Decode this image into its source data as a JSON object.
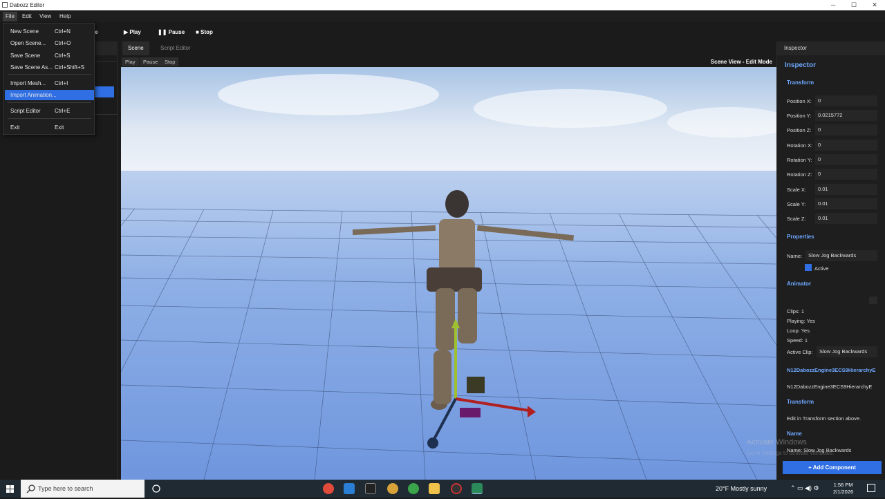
{
  "window": {
    "title": "Dabozz Editor",
    "minimize": "─",
    "maximize": "☐",
    "close": "✕"
  },
  "menubar": {
    "file": "File",
    "edit": "Edit",
    "view": "View",
    "help": "Help"
  },
  "toolbar": {
    "play": "▶ Play",
    "pause": "❚❚ Pause",
    "stop": "■ Stop",
    "partial": "e"
  },
  "file_menu": {
    "items": [
      {
        "label": "New Scene",
        "shortcut": "Ctrl+N"
      },
      {
        "label": "Open Scene...",
        "shortcut": "Ctrl+O"
      },
      {
        "label": "Save Scene",
        "shortcut": "Ctrl+S"
      },
      {
        "label": "Save Scene As...",
        "shortcut": "Ctrl+Shift+S"
      },
      {
        "label": "Import Mesh...",
        "shortcut": "Ctrl+I"
      },
      {
        "label": "Import Animation...",
        "shortcut": ""
      },
      {
        "label": "Script Editor",
        "shortcut": "Ctrl+E"
      },
      {
        "label": "Exit",
        "shortcut": "Exit"
      }
    ]
  },
  "tabs": [
    {
      "label": "Scene"
    },
    {
      "label": "Script Editor"
    }
  ],
  "viewbar": {
    "play": "Play",
    "pause": "Pause",
    "stop": "Stop",
    "mode": "Scene View - Edit Mode"
  },
  "inspector": {
    "tab": "Inspector",
    "header": "Inspector",
    "transform_title": "Transform",
    "fields": [
      {
        "label": "Position X:",
        "value": "0"
      },
      {
        "label": "Position Y:",
        "value": "0.0215772"
      },
      {
        "label": "Position Z:",
        "value": "0"
      },
      {
        "label": "Rotation X:",
        "value": "0"
      },
      {
        "label": "Rotation Y:",
        "value": "0"
      },
      {
        "label": "Rotation Z:",
        "value": "0"
      },
      {
        "label": "Scale X:",
        "value": "0.01"
      },
      {
        "label": "Scale Y:",
        "value": "0.01"
      },
      {
        "label": "Scale Z:",
        "value": "0.01"
      }
    ],
    "properties_title": "Properties",
    "name_label": "Name:",
    "name_value": "Slow Jog Backwards",
    "active_label": "Active",
    "animator_title": "Animator",
    "clips": "Clips: 1",
    "playing": "Playing: Yes",
    "loop": "Loop: Yes",
    "speed": "Speed: 1",
    "active_clip_label": "Active Clip:",
    "active_clip_value": "Slow Jog Backwards",
    "hierarchy_title": "N12DabozzEngine3ECS9HierarchyE",
    "hierarchy_text": "N12DabozzEngine3ECS9HierarchyE",
    "transform2_title": "Transform",
    "transform2_text": "Edit in Transform section above.",
    "name_title": "Name",
    "name_text": "Name: Slow Jog Backwards",
    "add_component": "+ Add Component"
  },
  "watermark": {
    "line1": "Activate Windows",
    "line2": "Go to Settings to activate Windows."
  },
  "taskbar": {
    "search_placeholder": "Type here to search",
    "weather": "20°F  Mostly sunny",
    "time": "1:56 PM",
    "date": "2/1/2026"
  },
  "colors": {
    "accent": "#2f6ee3",
    "section": "#6ea8ff"
  }
}
